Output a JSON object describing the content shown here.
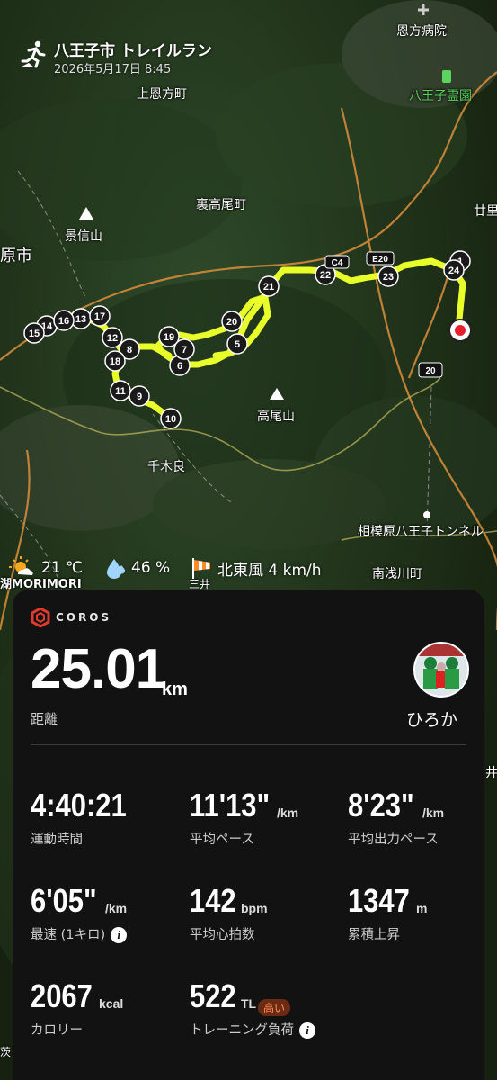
{
  "header": {
    "title": "八王子市 トレイルラン",
    "date": "2026年5月17日 8:45",
    "activity_icon": "trail-run-icon"
  },
  "map_labels": {
    "onkata_hospital": "恩方病院",
    "hachioji_cemetery": "八王子霊園",
    "kamionkata": "上恩方町",
    "urataka": "裏高尾町",
    "kagenobu": "景信山",
    "shi": "原市",
    "takao": "高尾山",
    "sengira": "千木良",
    "tunnel": "相模原八王子トンネル",
    "minamiasakawa": "南浅川町",
    "ni": "廿里",
    "ko": "湖",
    "sankai": "三井",
    "i": "井",
    "ibara": "茨",
    "road_c4": "C4",
    "road_e20": "E20",
    "road_20": "20"
  },
  "route": {
    "color": "#e8ff2a",
    "markers": [
      "1",
      "5",
      "6",
      "7",
      "8",
      "9",
      "10",
      "11",
      "12",
      "13",
      "14",
      "15",
      "16",
      "17",
      "18",
      "19",
      "20",
      "21",
      "22",
      "23",
      "24"
    ]
  },
  "weather": {
    "temperature": "21 ℃",
    "humidity": "46 %",
    "wind": "北東風 4 km/h",
    "morimori": "MORIMORI"
  },
  "card": {
    "brand": "COROS",
    "distance": {
      "value": "25.01",
      "unit": "km",
      "label": "距離"
    },
    "user": {
      "name": "ひろか"
    },
    "stats": [
      {
        "value": "4:40:21",
        "unit": "",
        "label": "運動時間"
      },
      {
        "value": "11'13\"",
        "unit": "/km",
        "label": "平均ペース"
      },
      {
        "value": "8'23\"",
        "unit": "/km",
        "label": "平均出力ペース"
      },
      {
        "value": "6'05\"",
        "unit": "/km",
        "label": "最速 (1キロ)"
      },
      {
        "value": "142",
        "unit": "bpm",
        "label": "平均心拍数"
      },
      {
        "value": "1347",
        "unit": "m",
        "label": "累積上昇"
      },
      {
        "value": "2067",
        "unit": "kcal",
        "label": "カロリー"
      },
      {
        "value": "522",
        "unit": "TL",
        "label": "トレーニング負荷",
        "badge": "高い"
      }
    ],
    "info_glyph": "i"
  }
}
